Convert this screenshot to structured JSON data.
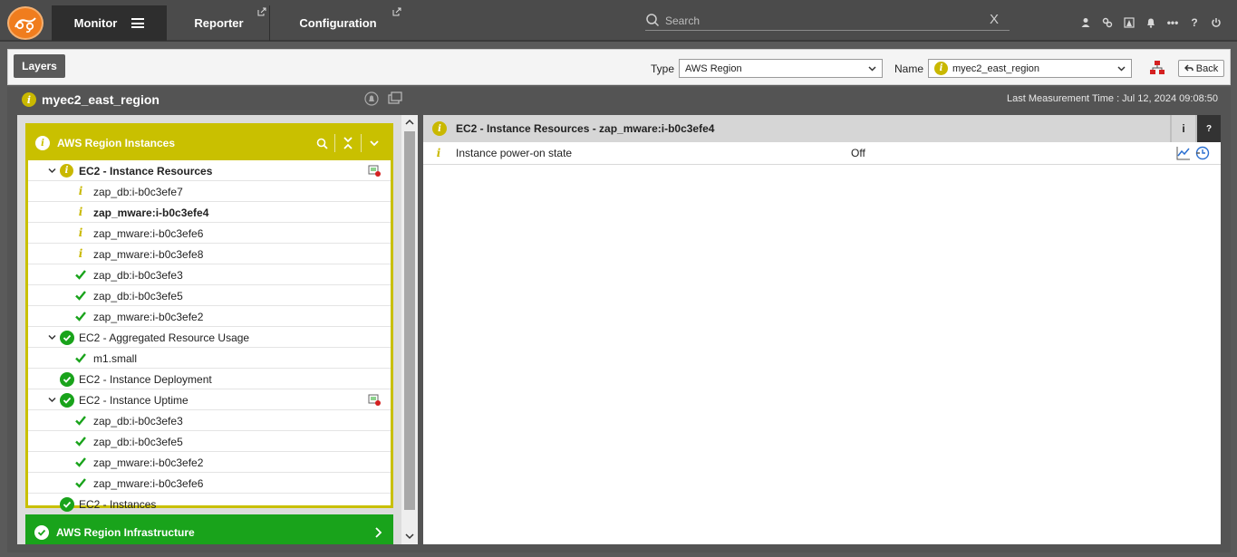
{
  "nav": {
    "monitor": "Monitor",
    "reporter": "Reporter",
    "configuration": "Configuration"
  },
  "search": {
    "placeholder": "Search",
    "clear": "X"
  },
  "top_icons": [
    "user-icon",
    "link-icon",
    "alarm-icon",
    "bell-icon",
    "more-icon",
    "help-icon",
    "power-icon"
  ],
  "top_icon_text": {
    "help": "?",
    "more": "•••"
  },
  "toolbar": {
    "layers": "Layers",
    "type_label": "Type",
    "type_value": "AWS Region",
    "name_label": "Name",
    "name_value": "myec2_east_region",
    "back": "Back"
  },
  "component": {
    "name": "myec2_east_region",
    "last_measurement": "Last Measurement Time : Jul 12, 2024 09:08:50"
  },
  "layers": {
    "group_title": "AWS Region Instances",
    "tests": [
      {
        "label": "EC2 - Instance Resources",
        "items": [
          "zap_db:i-b0c3efe7",
          "zap_mware:i-b0c3efe4",
          "zap_mware:i-b0c3efe6",
          "zap_mware:i-b0c3efe8",
          "zap_db:i-b0c3efe3",
          "zap_db:i-b0c3efe5",
          "zap_mware:i-b0c3efe2"
        ]
      },
      {
        "label": "EC2 - Aggregated Resource Usage",
        "items": [
          "m1.small"
        ]
      },
      {
        "label": "EC2 - Instance Deployment"
      },
      {
        "label": "EC2 - Instance Uptime",
        "items": [
          "zap_db:i-b0c3efe3",
          "zap_db:i-b0c3efe5",
          "zap_mware:i-b0c3efe2",
          "zap_mware:i-b0c3efe6"
        ]
      },
      {
        "label": "EC2 - Instances"
      }
    ],
    "group2_title": "AWS Region Infrastructure"
  },
  "detail": {
    "title": "EC2 - Instance Resources - zap_mware:i-b0c3efe4",
    "info_btn": "i",
    "help_btn": "?",
    "rows": [
      {
        "name": "Instance power-on state",
        "value": "Off"
      }
    ]
  },
  "colors": {
    "accent_orange": "#f07d1e",
    "info_yellow": "#c9c000",
    "ok_green": "#19a31b",
    "topbar": "#4b4b4b"
  }
}
